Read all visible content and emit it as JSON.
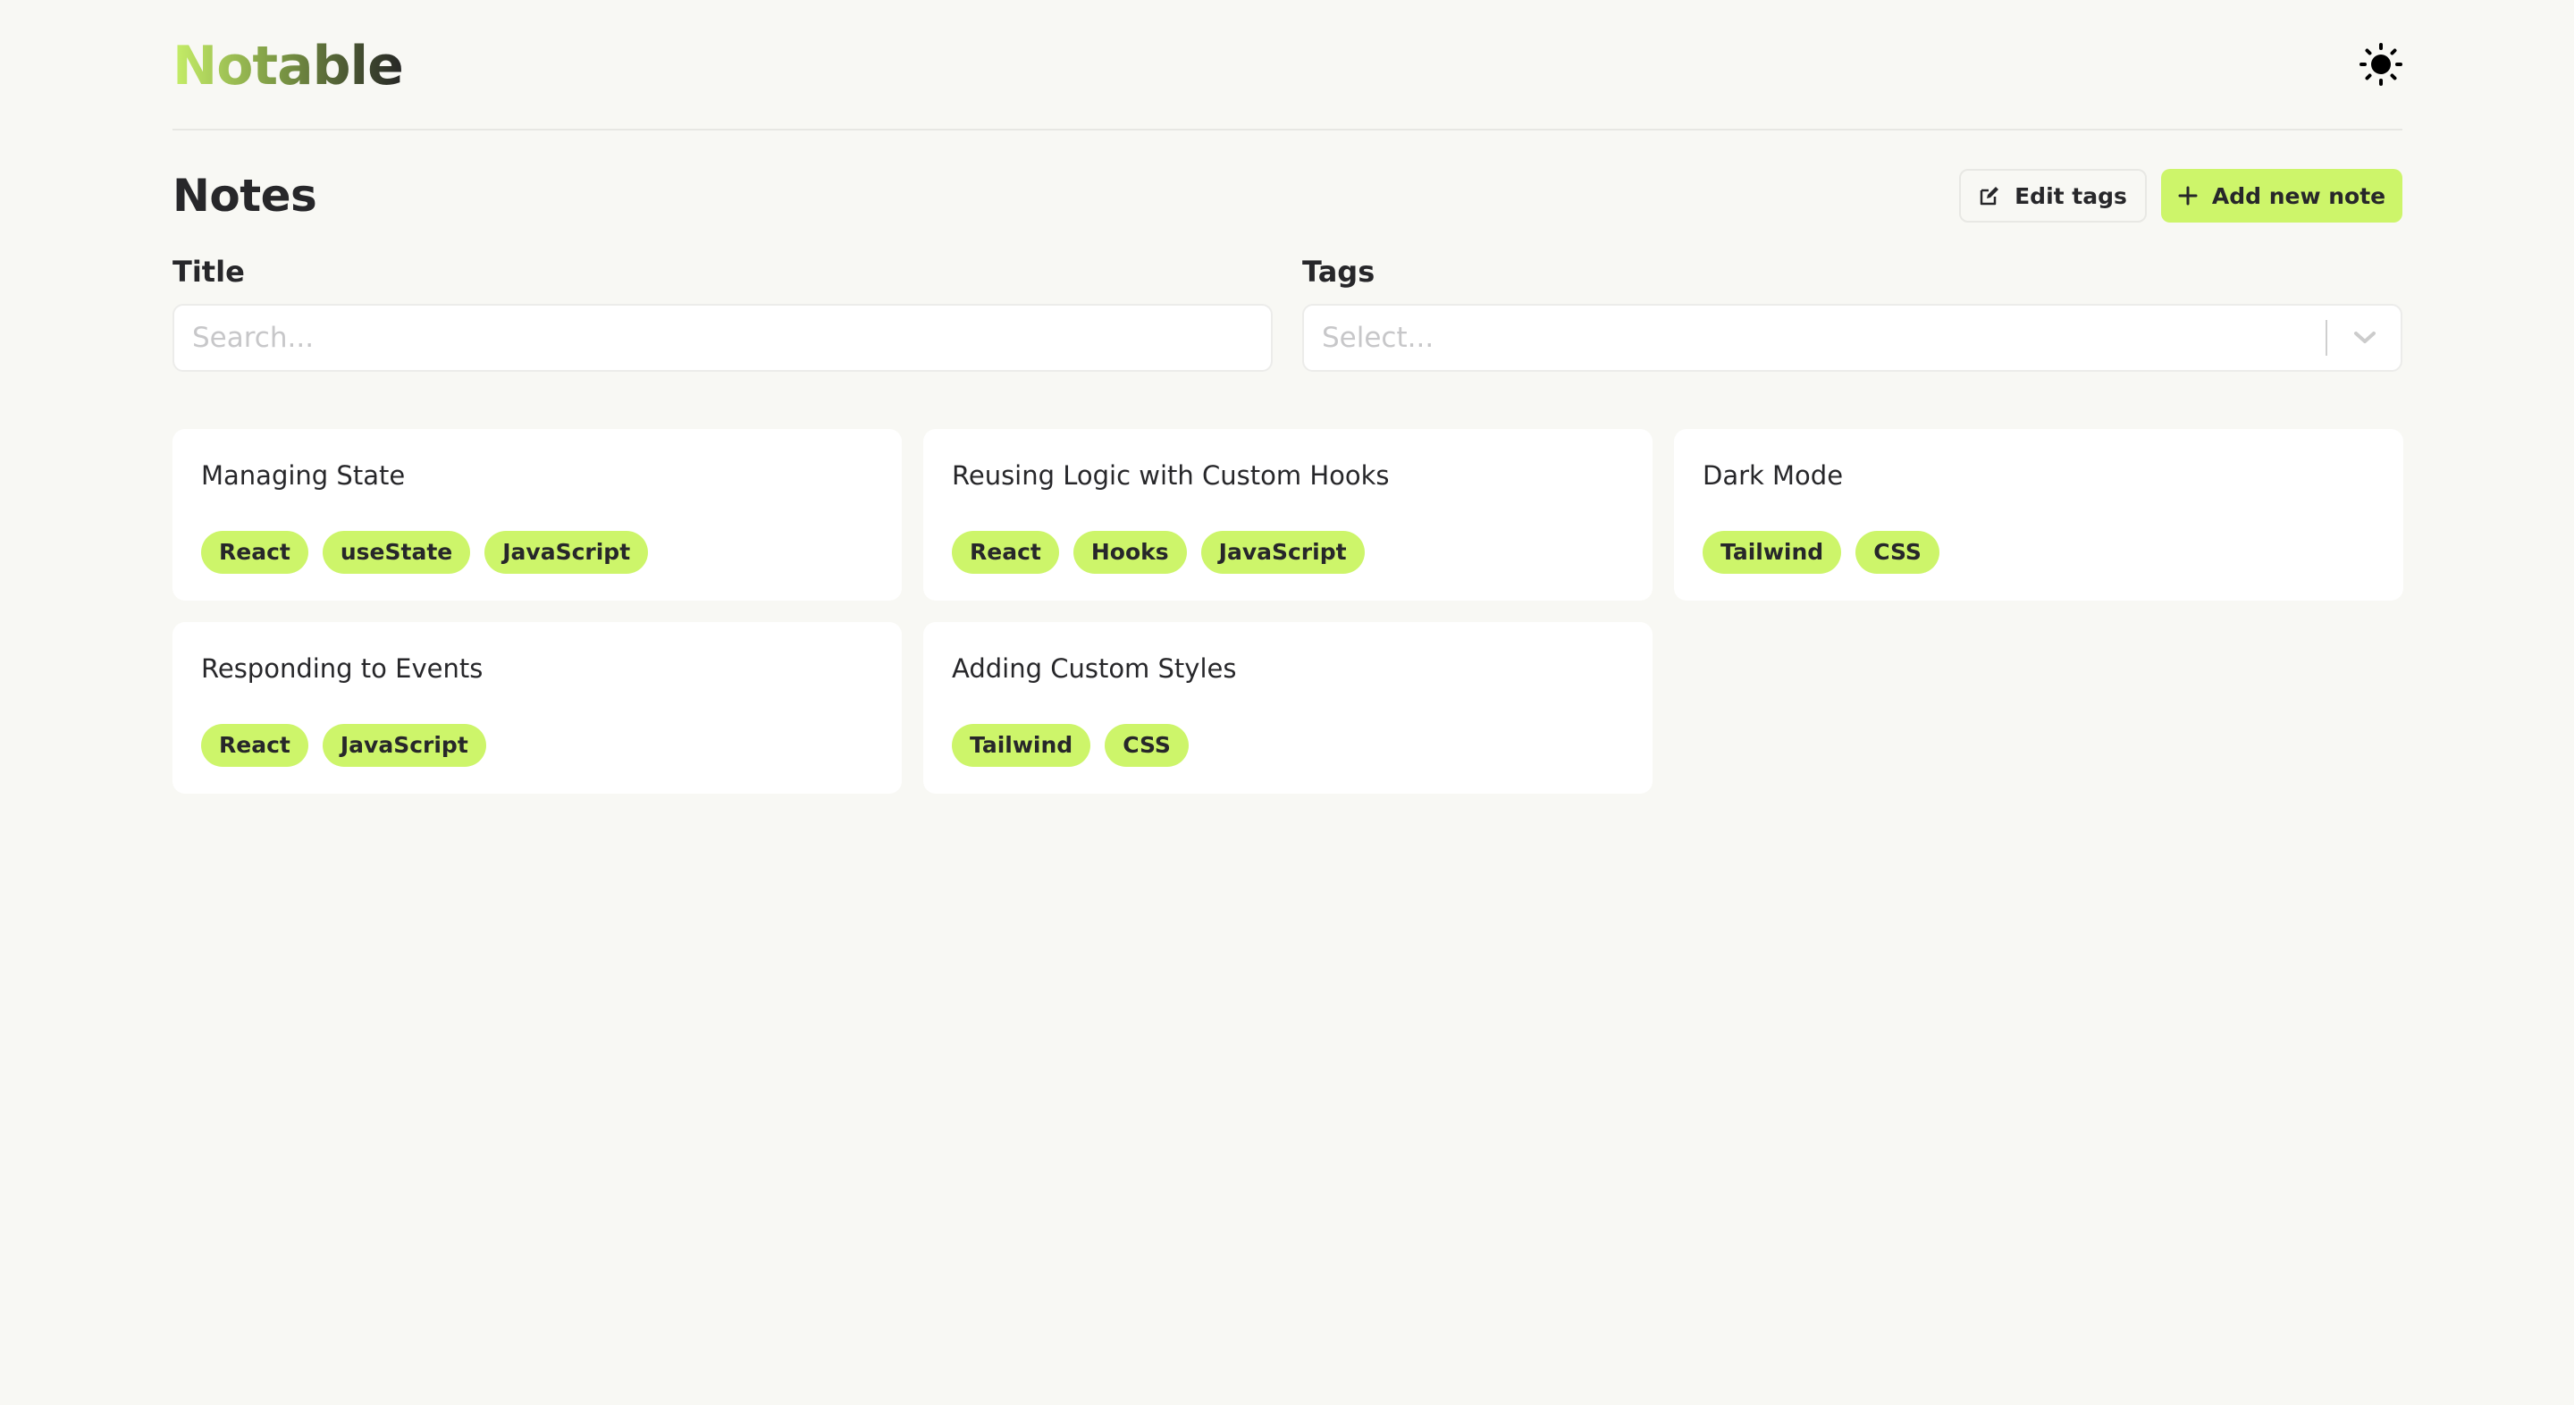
{
  "app": {
    "logo": "Notable",
    "theme_icon": "sun-icon"
  },
  "colors": {
    "accent": "#cdf56a",
    "background": "#f8f8f4",
    "text": "#27272a",
    "logo_gradient": [
      "#c6ef68",
      "#7d9a45",
      "#262626"
    ]
  },
  "toolbar": {
    "title": "Notes",
    "edit_tags_label": "Edit tags",
    "edit_tags_icon": "edit-icon",
    "add_note_label": "Add new note",
    "add_note_icon": "plus-icon"
  },
  "filters": {
    "title": {
      "label": "Title",
      "placeholder": "Search...",
      "value": ""
    },
    "tags": {
      "label": "Tags",
      "placeholder": "Select...",
      "icon": "chevron-down-icon"
    }
  },
  "notes": [
    {
      "title": "Managing State",
      "tags": [
        "React",
        "useState",
        "JavaScript"
      ]
    },
    {
      "title": "Reusing Logic with Custom Hooks",
      "tags": [
        "React",
        "Hooks",
        "JavaScript"
      ]
    },
    {
      "title": "Dark Mode",
      "tags": [
        "Tailwind",
        "CSS"
      ]
    },
    {
      "title": "Responding to Events",
      "tags": [
        "React",
        "JavaScript"
      ]
    },
    {
      "title": "Adding Custom Styles",
      "tags": [
        "Tailwind",
        "CSS"
      ]
    }
  ]
}
